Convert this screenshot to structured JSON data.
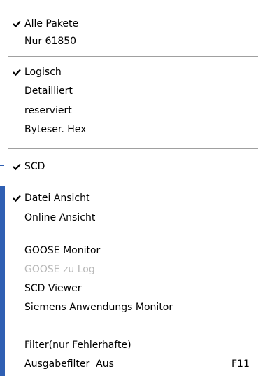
{
  "colors": {
    "menu_background": "#ffffff",
    "text": "#000000",
    "disabled_text": "#b8b8b8",
    "separator": "#a0a0a0",
    "background_accent": "#2f5fb3"
  },
  "menu": {
    "items": [
      {
        "label": "Alle Pakete",
        "checked": true,
        "enabled": true
      },
      {
        "label": "Nur 61850",
        "checked": false,
        "enabled": true
      },
      {
        "label": "Logisch",
        "checked": true,
        "enabled": true
      },
      {
        "label": "Detailliert",
        "checked": false,
        "enabled": true
      },
      {
        "label": "reserviert",
        "checked": false,
        "enabled": true
      },
      {
        "label": "Byteser. Hex",
        "checked": false,
        "enabled": true
      },
      {
        "label": "SCD",
        "checked": true,
        "enabled": true
      },
      {
        "label": "Datei Ansicht",
        "checked": true,
        "enabled": true
      },
      {
        "label": "Online Ansicht",
        "checked": false,
        "enabled": true
      },
      {
        "label": "GOOSE Monitor",
        "checked": false,
        "enabled": true
      },
      {
        "label": "GOOSE zu Log",
        "checked": false,
        "enabled": false
      },
      {
        "label": "SCD Viewer",
        "checked": false,
        "enabled": true
      },
      {
        "label": "Siemens Anwendungs Monitor",
        "checked": false,
        "enabled": true
      },
      {
        "label": "Filter(nur Fehlerhafte)",
        "checked": false,
        "enabled": true
      },
      {
        "label": "Ausgabefilter  Aus",
        "shortcut": "F11",
        "checked": false,
        "enabled": true
      }
    ]
  }
}
